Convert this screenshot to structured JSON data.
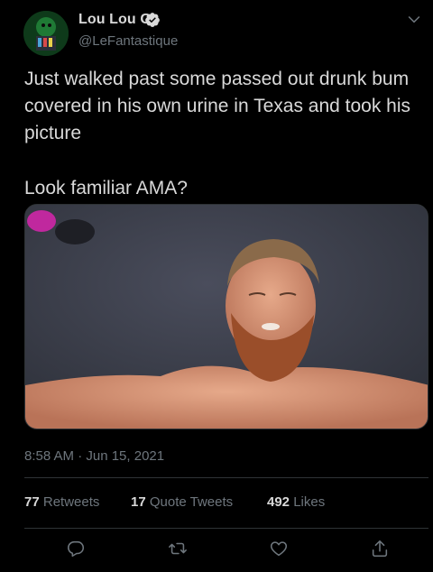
{
  "author": {
    "display_name": "Lou Lou G",
    "handle": "@LeFantastique",
    "verified": true,
    "avatar": "avatar-image"
  },
  "tweet": {
    "text_line_1": "Just walked past some passed out drunk bum covered in his own urine in Texas and took his picture",
    "text_line_2": "Look familiar AMA?",
    "timestamp": "8:58 AM · Jun 15, 2021"
  },
  "stats": {
    "retweets_count": "77",
    "retweets_label": "Retweets",
    "quote_tweets_count": "17",
    "quote_tweets_label": "Quote Tweets",
    "likes_count": "492",
    "likes_label": "Likes"
  },
  "icons": {
    "verified": "verified-badge-icon",
    "more": "chevron-down-icon",
    "reply": "reply-icon",
    "retweet": "retweet-icon",
    "like": "heart-icon",
    "share": "share-icon"
  },
  "colors": {
    "background": "#000000",
    "text": "#d9d9d9",
    "secondary_text": "#6e767d",
    "divider": "#2f3336"
  }
}
